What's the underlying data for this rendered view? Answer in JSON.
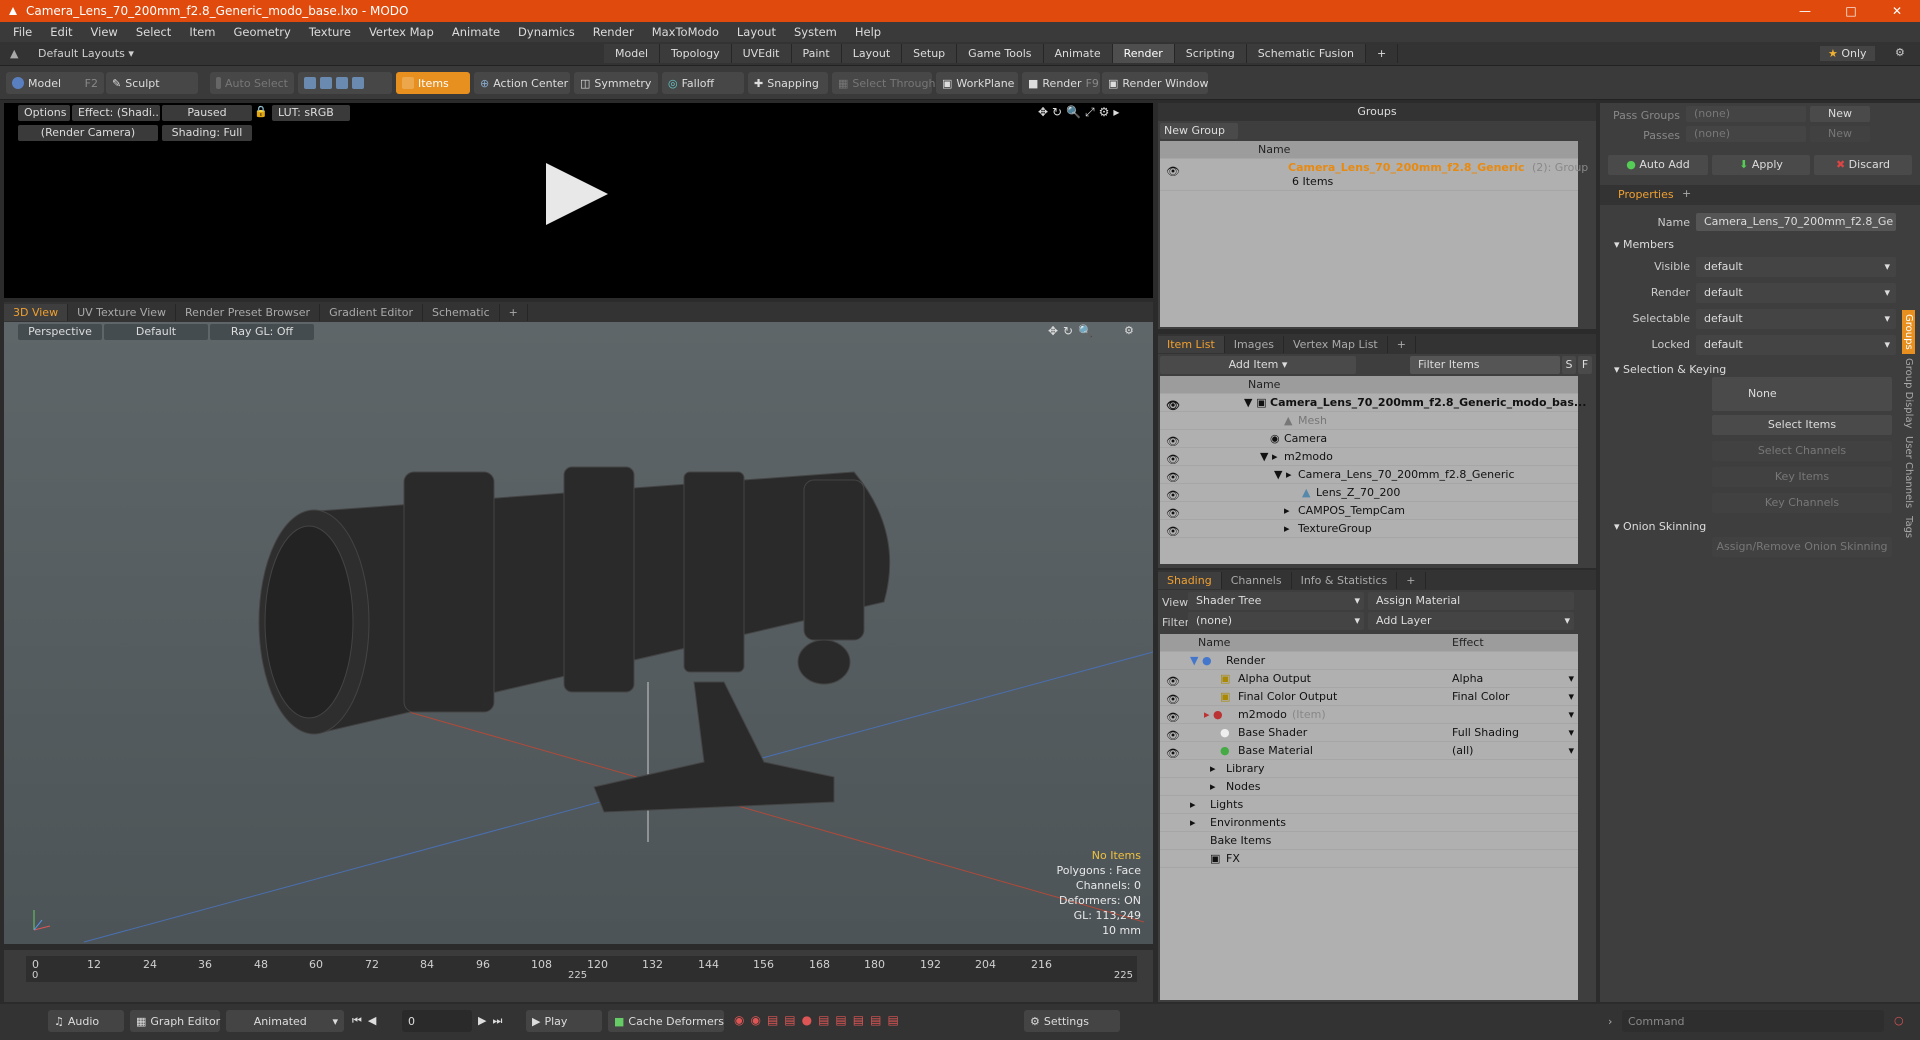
{
  "window": {
    "title": "Camera_Lens_70_200mm_f2.8_Generic_modo_base.lxo - MODO"
  },
  "menu": [
    "File",
    "Edit",
    "View",
    "Select",
    "Item",
    "Geometry",
    "Texture",
    "Vertex Map",
    "Animate",
    "Dynamics",
    "Render",
    "MaxToModo",
    "Layout",
    "System",
    "Help"
  ],
  "layout": {
    "default_layouts": "Default Layouts",
    "only": "Only",
    "tabs": [
      "Model",
      "Topology",
      "UVEdit",
      "Paint",
      "Layout",
      "Setup",
      "Game Tools",
      "Animate",
      "Render",
      "Scripting",
      "Schematic Fusion"
    ],
    "active_tab": "Render"
  },
  "toolbar": {
    "model": "Model",
    "model_key": "F2",
    "sculpt": "Sculpt",
    "auto_select": "Auto Select",
    "items": "Items",
    "action_center": "Action Center",
    "symmetry": "Symmetry",
    "falloff": "Falloff",
    "snapping": "Snapping",
    "select_through": "Select Through",
    "workplane": "WorkPlane",
    "render": "Render",
    "render_key": "F9",
    "render_window": "Render Window"
  },
  "render_view": {
    "options": "Options",
    "effect": "Effect: (Shadi...",
    "paused": "Paused",
    "lut": "LUT: sRGB",
    "camera": "(Render Camera)",
    "shading": "Shading: Full"
  },
  "viewport_tabs": [
    "3D View",
    "UV Texture View",
    "Render Preset Browser",
    "Gradient Editor",
    "Schematic"
  ],
  "viewport": {
    "perspective": "Perspective",
    "default": "Default",
    "raygl": "Ray GL: Off",
    "stats": [
      "No Items",
      "Polygons : Face",
      "Channels: 0",
      "Deformers: ON",
      "GL: 113,249",
      "10 mm"
    ]
  },
  "timeline": {
    "ticks": [
      "0",
      "12",
      "24",
      "36",
      "48",
      "60",
      "72",
      "84",
      "96",
      "108",
      "120",
      "132",
      "144",
      "156",
      "168",
      "180",
      "192",
      "204",
      "216"
    ],
    "sub_ticks": [
      "0",
      "225",
      "225"
    ]
  },
  "bottom": {
    "audio": "Audio",
    "graph_editor": "Graph Editor",
    "animated": "Animated",
    "frame": "0",
    "play": "Play",
    "cache": "Cache Deformers",
    "settings": "Settings",
    "command": "Command"
  },
  "groups": {
    "title": "Groups",
    "new_group": "New Group",
    "col_name": "Name",
    "group_name": "Camera_Lens_70_200mm_f2.8_Generic",
    "group_count": "(2)",
    "group_type": ": Group",
    "group_items": "6 Items"
  },
  "itemlist": {
    "tabs": [
      "Item List",
      "Images",
      "Vertex Map List"
    ],
    "add_item": "Add Item",
    "filter": "Filter Items",
    "s": "S",
    "f": "F",
    "col_name": "Name",
    "items": [
      "Camera_Lens_70_200mm_f2.8_Generic_modo_bas...",
      "Mesh",
      "Camera",
      "m2modo",
      "Camera_Lens_70_200mm_f2.8_Generic",
      "Lens_Z_70_200",
      "CAMPOS_TempCam",
      "TextureGroup"
    ]
  },
  "shading": {
    "tabs": [
      "Shading",
      "Channels",
      "Info & Statistics"
    ],
    "view_label": "View",
    "view": "Shader Tree",
    "assign": "Assign Material",
    "filter_label": "Filter",
    "filter": "(none)",
    "add_layer": "Add Layer",
    "col_name": "Name",
    "col_effect": "Effect",
    "rows": [
      {
        "name": "Render",
        "effect": ""
      },
      {
        "name": "Alpha Output",
        "effect": "Alpha"
      },
      {
        "name": "Final Color Output",
        "effect": "Final Color"
      },
      {
        "name": "m2modo",
        "effect": "",
        "note": "(Item)"
      },
      {
        "name": "Base Shader",
        "effect": "Full Shading"
      },
      {
        "name": "Base Material",
        "effect": "(all)"
      },
      {
        "name": "Library",
        "effect": ""
      },
      {
        "name": "Nodes",
        "effect": ""
      },
      {
        "name": "Lights",
        "effect": ""
      },
      {
        "name": "Environments",
        "effect": ""
      },
      {
        "name": "Bake Items",
        "effect": ""
      },
      {
        "name": "FX",
        "effect": ""
      }
    ]
  },
  "props": {
    "pass_groups": "Pass Groups",
    "passes": "Passes",
    "none": "(none)",
    "new": "New",
    "auto_add": "Auto Add",
    "apply": "Apply",
    "discard": "Discard",
    "tab": "Properties",
    "name_label": "Name",
    "name_value": "Camera_Lens_70_200mm_f2.8_Ge",
    "members": "Members",
    "visible": "Visible",
    "render": "Render",
    "selectable": "Selectable",
    "locked": "Locked",
    "default": "default",
    "sel_keying": "Selection & Keying",
    "none_btn": "None",
    "select_items": "Select Items",
    "select_channels": "Select Channels",
    "key_items": "Key Items",
    "key_channels": "Key Channels",
    "onion": "Onion Skinning",
    "assign_onion": "Assign/Remove Onion Skinning",
    "vtabs": [
      "Groups",
      "Group Display",
      "User Channels",
      "Tags"
    ]
  }
}
